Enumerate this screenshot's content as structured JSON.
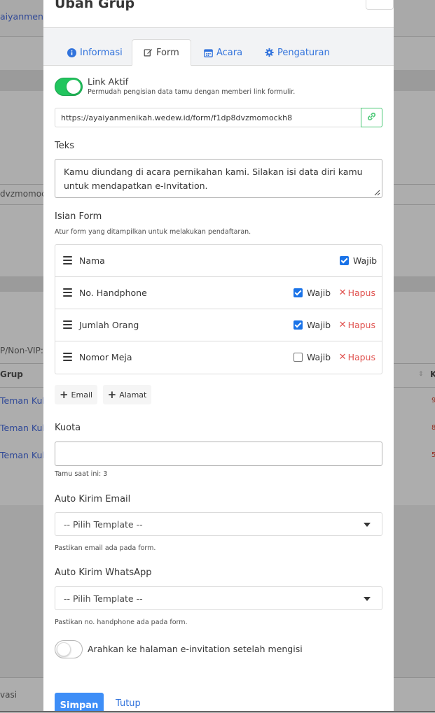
{
  "background": {
    "site_name": "aiyanmenik",
    "url_fragment": "dvzmomock",
    "vip_label": "P/Non-VIP:",
    "col_grup": "Grup",
    "col_k": "K",
    "rows": [
      "Teman Kul",
      "Teman Kul",
      "Teman Kul"
    ],
    "row_nums": [
      "9",
      "8",
      "5"
    ],
    "footer_text": "vasi"
  },
  "modal": {
    "title": "Ubah Grup",
    "close_icon": "close-icon"
  },
  "tabs": [
    {
      "label": "Informasi",
      "icon": "info-circle-icon"
    },
    {
      "label": "Form",
      "icon": "edit-icon"
    },
    {
      "label": "Acara",
      "icon": "calendar-icon"
    },
    {
      "label": "Pengaturan",
      "icon": "gear-icon"
    }
  ],
  "link_aktif": {
    "label": "Link Aktif",
    "help": "Permudah pengisian data tamu dengan memberi link formulir.",
    "enabled": true,
    "url": "https://ayaiyanmenikah.wedew.id/form/f1dp8dvzmomockh8"
  },
  "teks": {
    "label": "Teks",
    "value": "Kamu diundang di acara pernikahan kami. Silakan isi data diri kamu untuk mendapatkan e-Invitation."
  },
  "isian_form": {
    "label": "Isian Form",
    "help": "Atur form yang ditampilkan untuk melakukan pendaftaran.",
    "wajib_label": "Wajib",
    "hapus_label": "Hapus",
    "fields": [
      {
        "name": "Nama",
        "required": true,
        "removable": false
      },
      {
        "name": "No. Handphone",
        "required": true,
        "removable": true
      },
      {
        "name": "Jumlah Orang",
        "required": true,
        "removable": true
      },
      {
        "name": "Nomor Meja",
        "required": false,
        "removable": true
      }
    ],
    "add_email": "Email",
    "add_alamat": "Alamat"
  },
  "kuota": {
    "label": "Kuota",
    "value": "",
    "help": "Tamu saat ini: 3"
  },
  "auto_email": {
    "label": "Auto Kirim Email",
    "selected": "-- Pilih Template --",
    "help": "Pastikan email ada pada form."
  },
  "auto_whatsapp": {
    "label": "Auto Kirim WhatsApp",
    "selected": "-- Pilih Template --",
    "help": "Pastikan no. handphone ada pada form."
  },
  "redirect": {
    "label": "Arahkan ke halaman e-invitation setelah mengisi",
    "enabled": false
  },
  "footer": {
    "save": "Simpan",
    "close": "Tutup"
  },
  "colors": {
    "accent": "#3273dc",
    "success": "#22c55e",
    "danger": "#e0524f",
    "primary_button": "#3e8ef7"
  }
}
